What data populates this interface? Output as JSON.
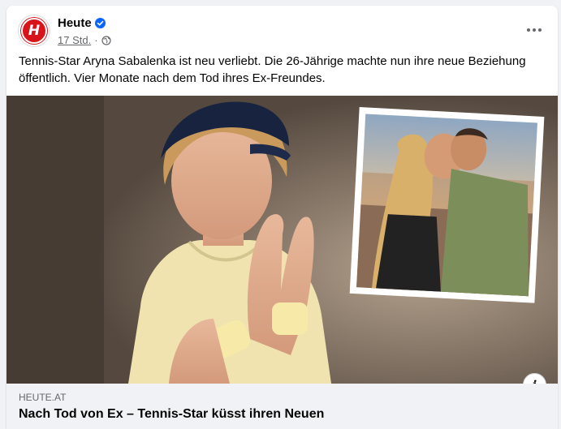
{
  "post": {
    "page_name": "Heute",
    "avatar_letter": "H",
    "timestamp": "17 Std.",
    "separator": "·",
    "text": "Tennis-Star Aryna Sabalenka ist neu verliebt. Die 26-Jährige machte nun ihre neue Beziehung öffentlich. Vier Monate nach dem Tod ihres Ex-Freundes."
  },
  "link_preview": {
    "domain": "HEUTE.AT",
    "headline": "Nach Tod von Ex – Tennis-Star küsst ihren Neuen"
  },
  "icons": {
    "verified": "verified-badge-icon",
    "privacy": "globe-icon",
    "more": "more-options-icon",
    "info": "info-icon"
  },
  "colors": {
    "brand_red": "#d7141a",
    "verified_blue": "#0866ff",
    "text_primary": "#050505",
    "text_secondary": "#65676b",
    "preview_bg": "#f0f2f5"
  }
}
